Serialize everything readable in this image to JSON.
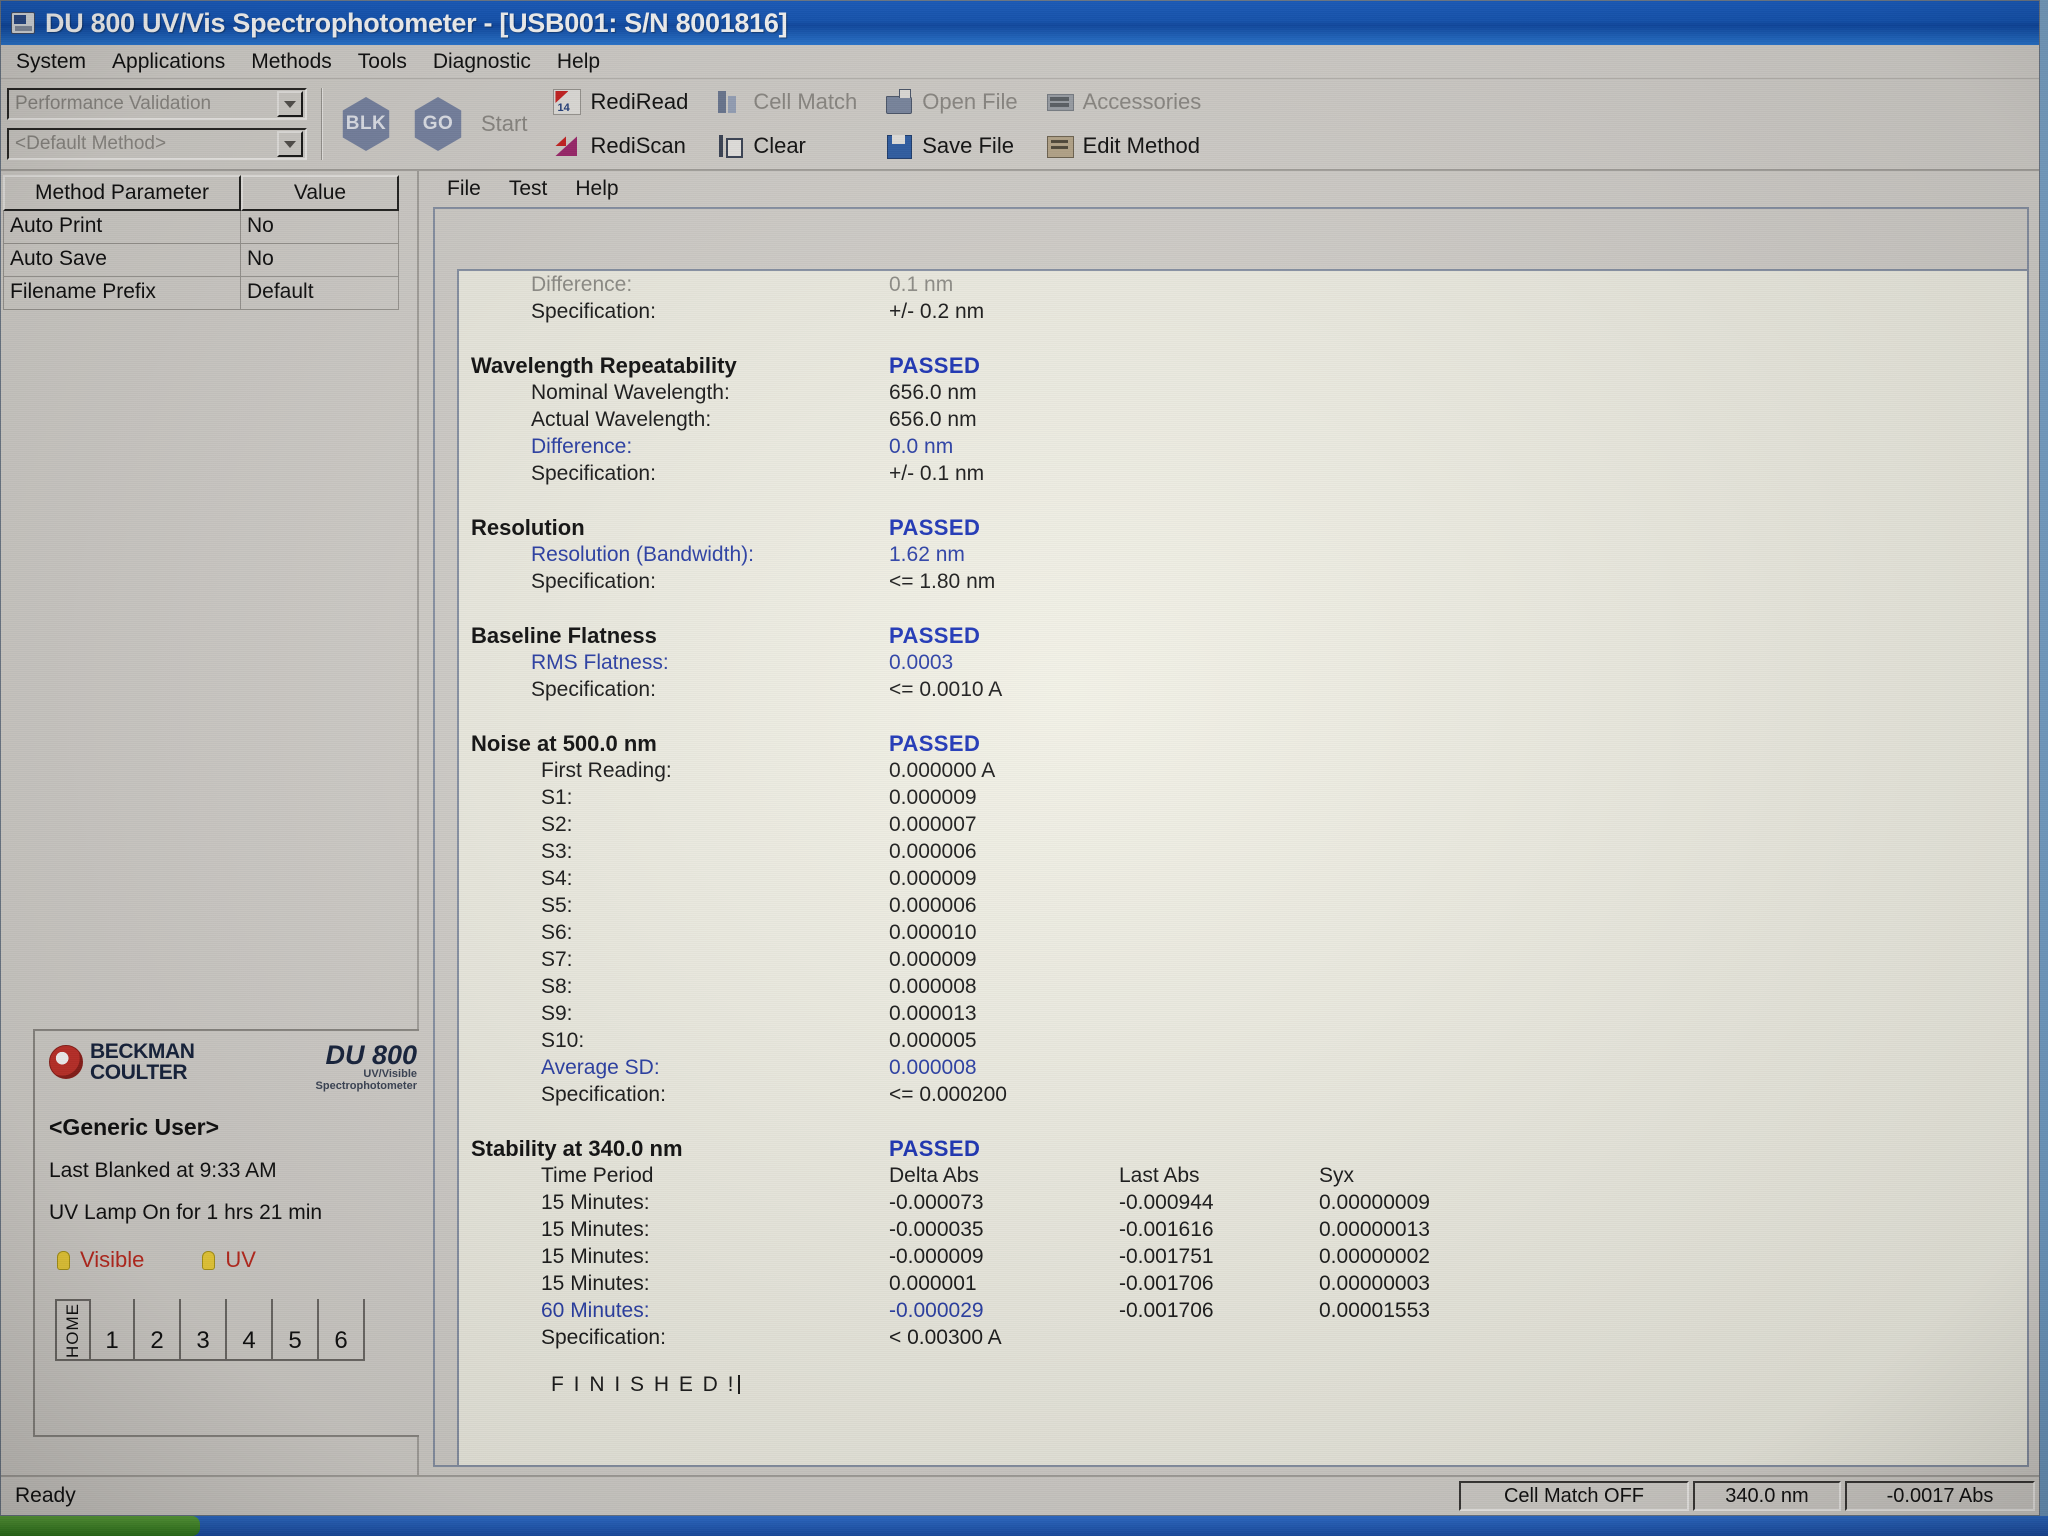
{
  "window": {
    "title": "DU 800 UV/Vis Spectrophotometer  - [USB001: S/N 8001816]",
    "icon": "spectrophotometer-icon"
  },
  "menubar": {
    "items": [
      "System",
      "Applications",
      "Methods",
      "Tools",
      "Diagnostic",
      "Help"
    ]
  },
  "toolbar": {
    "application_combo": {
      "value": "Performance Validation",
      "arrow_icon": "chevron-down-icon"
    },
    "method_combo": {
      "value": "<Default Method>",
      "arrow_icon": "chevron-down-icon"
    },
    "blk_button": "BLK",
    "go_button": "GO",
    "start_label": "Start",
    "buttons": [
      {
        "label": "RediRead",
        "icon": "rediread-icon",
        "disabled": false
      },
      {
        "label": "Cell Match",
        "icon": "cellmatch-icon",
        "disabled": true
      },
      {
        "label": "Open File",
        "icon": "openfile-icon",
        "disabled": true
      },
      {
        "label": "Accessories",
        "icon": "accessories-icon",
        "disabled": true
      },
      {
        "label": "RediScan",
        "icon": "rediscan-icon",
        "disabled": false
      },
      {
        "label": "Clear",
        "icon": "clear-icon",
        "disabled": false
      },
      {
        "label": "Save File",
        "icon": "savefile-icon",
        "disabled": false
      },
      {
        "label": "Edit Method",
        "icon": "editmethod-icon",
        "disabled": false
      }
    ]
  },
  "parameter_table": {
    "headers": [
      "Method Parameter",
      "Value"
    ],
    "rows": [
      {
        "parameter": "Auto Print",
        "value": "No"
      },
      {
        "parameter": "Auto Save",
        "value": "No"
      },
      {
        "parameter": "Filename Prefix",
        "value": "Default"
      }
    ]
  },
  "instrument_panel": {
    "brand_line1": "BECKMAN",
    "brand_line2": "COULTER",
    "model": "DU 800",
    "model_sub1": "UV/Visible",
    "model_sub2": "Spectrophotometer",
    "user": "<Generic User>",
    "last_blanked": "Last Blanked at 9:33 AM",
    "lamp_status": "UV Lamp On for 1 hrs 21 min",
    "lamps": [
      {
        "label": "Visible",
        "on": true
      },
      {
        "label": "UV",
        "on": true
      }
    ],
    "home_label": "HOME",
    "cells": [
      "1",
      "2",
      "3",
      "4",
      "5",
      "6"
    ]
  },
  "child_window": {
    "menubar": [
      "File",
      "Test",
      "Help"
    ]
  },
  "report": {
    "clipped_top": {
      "label": "Difference:",
      "value": "0.1 nm"
    },
    "top_specification": {
      "label": "Specification:",
      "value": "+/- 0.2 nm"
    },
    "sections": [
      {
        "title": "Wavelength Repeatability",
        "status": "PASSED",
        "rows": [
          {
            "label": "Nominal Wavelength:",
            "value": "656.0 nm",
            "highlight": false
          },
          {
            "label": "Actual Wavelength:",
            "value": "656.0 nm",
            "highlight": false
          },
          {
            "label": "Difference:",
            "value": "0.0 nm",
            "highlight": true
          },
          {
            "label": "Specification:",
            "value": "+/- 0.1 nm",
            "highlight": false
          }
        ]
      },
      {
        "title": "Resolution",
        "status": "PASSED",
        "rows": [
          {
            "label": "Resolution (Bandwidth):",
            "value": "1.62 nm",
            "highlight": true
          },
          {
            "label": "Specification:",
            "value": "<=  1.80 nm",
            "highlight": false
          }
        ]
      },
      {
        "title": "Baseline Flatness",
        "status": "PASSED",
        "rows": [
          {
            "label": "RMS Flatness:",
            "value": "0.0003",
            "highlight": true
          },
          {
            "label": "Specification:",
            "value": "<= 0.0010 A",
            "highlight": false
          }
        ]
      },
      {
        "title": "Noise at 500.0 nm",
        "status": "PASSED",
        "rows": [
          {
            "label": "First Reading:",
            "value": "0.000000 A",
            "highlight": false
          },
          {
            "label": "S1:",
            "value": "0.000009",
            "highlight": false
          },
          {
            "label": "S2:",
            "value": "0.000007",
            "highlight": false
          },
          {
            "label": "S3:",
            "value": "0.000006",
            "highlight": false
          },
          {
            "label": "S4:",
            "value": "0.000009",
            "highlight": false
          },
          {
            "label": "S5:",
            "value": "0.000006",
            "highlight": false
          },
          {
            "label": "S6:",
            "value": "0.000010",
            "highlight": false
          },
          {
            "label": "S7:",
            "value": "0.000009",
            "highlight": false
          },
          {
            "label": "S8:",
            "value": "0.000008",
            "highlight": false
          },
          {
            "label": "S9:",
            "value": "0.000013",
            "highlight": false
          },
          {
            "label": "S10:",
            "value": "0.000005",
            "highlight": false
          },
          {
            "label": "Average SD:",
            "value": "0.000008",
            "highlight": true
          },
          {
            "label": "Specification:",
            "value": "<= 0.000200",
            "highlight": false
          }
        ]
      }
    ],
    "stability": {
      "title": "Stability at 340.0 nm",
      "status": "PASSED",
      "columns": [
        "Time Period",
        "Delta Abs",
        "Last Abs",
        "Syx"
      ],
      "rows": [
        {
          "period": "15 Minutes:",
          "delta_abs": "-0.000073",
          "last_abs": "-0.000944",
          "syx": "0.00000009",
          "highlight": false
        },
        {
          "period": "15 Minutes:",
          "delta_abs": "-0.000035",
          "last_abs": "-0.001616",
          "syx": "0.00000013",
          "highlight": false
        },
        {
          "period": "15 Minutes:",
          "delta_abs": "-0.000009",
          "last_abs": "-0.001751",
          "syx": "0.00000002",
          "highlight": false
        },
        {
          "period": "15 Minutes:",
          "delta_abs": "0.000001",
          "last_abs": "-0.001706",
          "syx": "0.00000003",
          "highlight": false
        },
        {
          "period": "60 Minutes:",
          "delta_abs": "-0.000029",
          "last_abs": "-0.001706",
          "syx": "0.00001553",
          "highlight": true
        }
      ],
      "specification_label": "Specification:",
      "specification_value": "< 0.00300 A"
    },
    "finished_text": "F I N I S H E D !"
  },
  "statusbar": {
    "state": "Ready",
    "cell_match": "Cell Match OFF",
    "wavelength": "340.0 nm",
    "absorbance": "-0.0017 Abs"
  }
}
